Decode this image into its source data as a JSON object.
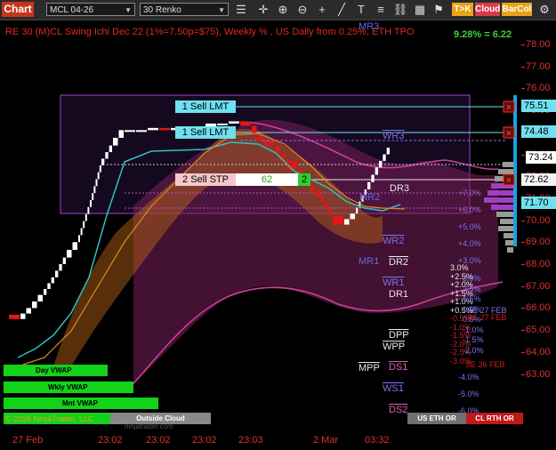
{
  "toolbar": {
    "chart_tab": "Chart",
    "symbol": "MCL 04-26",
    "interval": "30 Renko",
    "link_label": "Not Linked",
    "icons": [
      "crosshair-icon",
      "pan-icon",
      "zoom-in-icon",
      "zoom-out-icon",
      "add-icon",
      "draw-line-icon",
      "text-icon",
      "menu-icon",
      "bars-icon"
    ],
    "buttons": {
      "tok": "T>K",
      "cloud": "Cloud",
      "barcol": "BarCol"
    },
    "colors": {
      "tok": "#e8a317",
      "cloud": "#d93a4a",
      "barcol": "#e8a317"
    }
  },
  "header": {
    "title": "RE 30 (M)CL Swing Ichi Dec 22  (1%=7.50p=$75), Weekly % , US Daily from 0.25%, ETH TPO",
    "pct": "9.28% = 6.22"
  },
  "axis": {
    "ticks": [
      "78.00",
      "77.00",
      "76.00",
      "75.00",
      "74.00",
      "73.00",
      "72.00",
      "71.00",
      "70.00",
      "69.00",
      "68.00",
      "67.00",
      "66.00",
      "65.00",
      "64.00",
      "63.00"
    ],
    "last": "73.24",
    "tags": [
      "75.51",
      "74.48",
      "72.62",
      "71.70"
    ]
  },
  "orders": [
    {
      "label": "1 Sell LMT",
      "qty": ""
    },
    {
      "label": "1 Sell LMT",
      "qty": ""
    },
    {
      "label": "2 Sell STP",
      "qty": "62",
      "extra": "2"
    }
  ],
  "levels": {
    "mr3": "MR3",
    "wr3": "WR3",
    "mr2": "MR2",
    "dr3": "DR3",
    "wr2": "WR2",
    "mr1": "MR1",
    "dr2": "DR2",
    "wr1": "WR1",
    "dr1": "DR1",
    "dpp": "DPP",
    "wpp": "WPP",
    "mpp": "MPP",
    "ds1": "DS1",
    "ws1": "WS1",
    "ds2": "DS2"
  },
  "weekly_pct": [
    "+7.0%",
    "+6.0%",
    "+5.0%",
    "+4.0%",
    "+3.0%",
    "-4.0%",
    "-5.0%",
    "-6.0%"
  ],
  "daily_pct": [
    "3.0%",
    "+2.5%",
    "+2.0%",
    "+1.5%",
    "+1.0%",
    "+0.5%",
    "-0.5%",
    "-1.0%",
    "-1.5%",
    "-2.0%",
    "-2.5%",
    "-3.0%"
  ],
  "daily_pct_right": [
    "3.0%",
    "2.5%",
    "1.5%",
    "1.0%",
    "0.5%",
    "-1.0%",
    "-1.5%",
    "-2.0%"
  ],
  "settlements": {
    "se27": "SE 27 FEB",
    "se27b": "SE 27 FEB",
    "se26": "SE 26 FEB"
  },
  "bottom_bars": {
    "day_vwap": "Day VWAP",
    "wkly_vwap": "Wkly VWAP",
    "mnt_vwap": "Mnt VWAP",
    "outside_cloud": "Outside Cloud",
    "copyright": "© 2026 NinjaTrader, LLC",
    "watermark": "ninjatrader.com",
    "us_eth": "US ETH OR",
    "cl_rth": "CL RTH OR"
  },
  "time_axis": [
    "27 Feb",
    "23:02",
    "23:02",
    "23:02",
    "23:03",
    "2 Mar",
    "03:32"
  ],
  "chart_data": {
    "type": "line",
    "series": [
      {
        "values": [
          65.7,
          65.5,
          66.0,
          66.6,
          67.4,
          68.3,
          69.0,
          70.6,
          72.5,
          73.4,
          74.1,
          74.1,
          74.1,
          74.2,
          74.1,
          74.2,
          74.0,
          74.1,
          74.4,
          74.4,
          74.5,
          74.3,
          73.6,
          73.4,
          72.7,
          72.3,
          71.6,
          71.1,
          70.2,
          69.8,
          70.3,
          71.4,
          72.4,
          73.3
        ]
      }
    ],
    "ylim": [
      63.0,
      78.5
    ]
  }
}
